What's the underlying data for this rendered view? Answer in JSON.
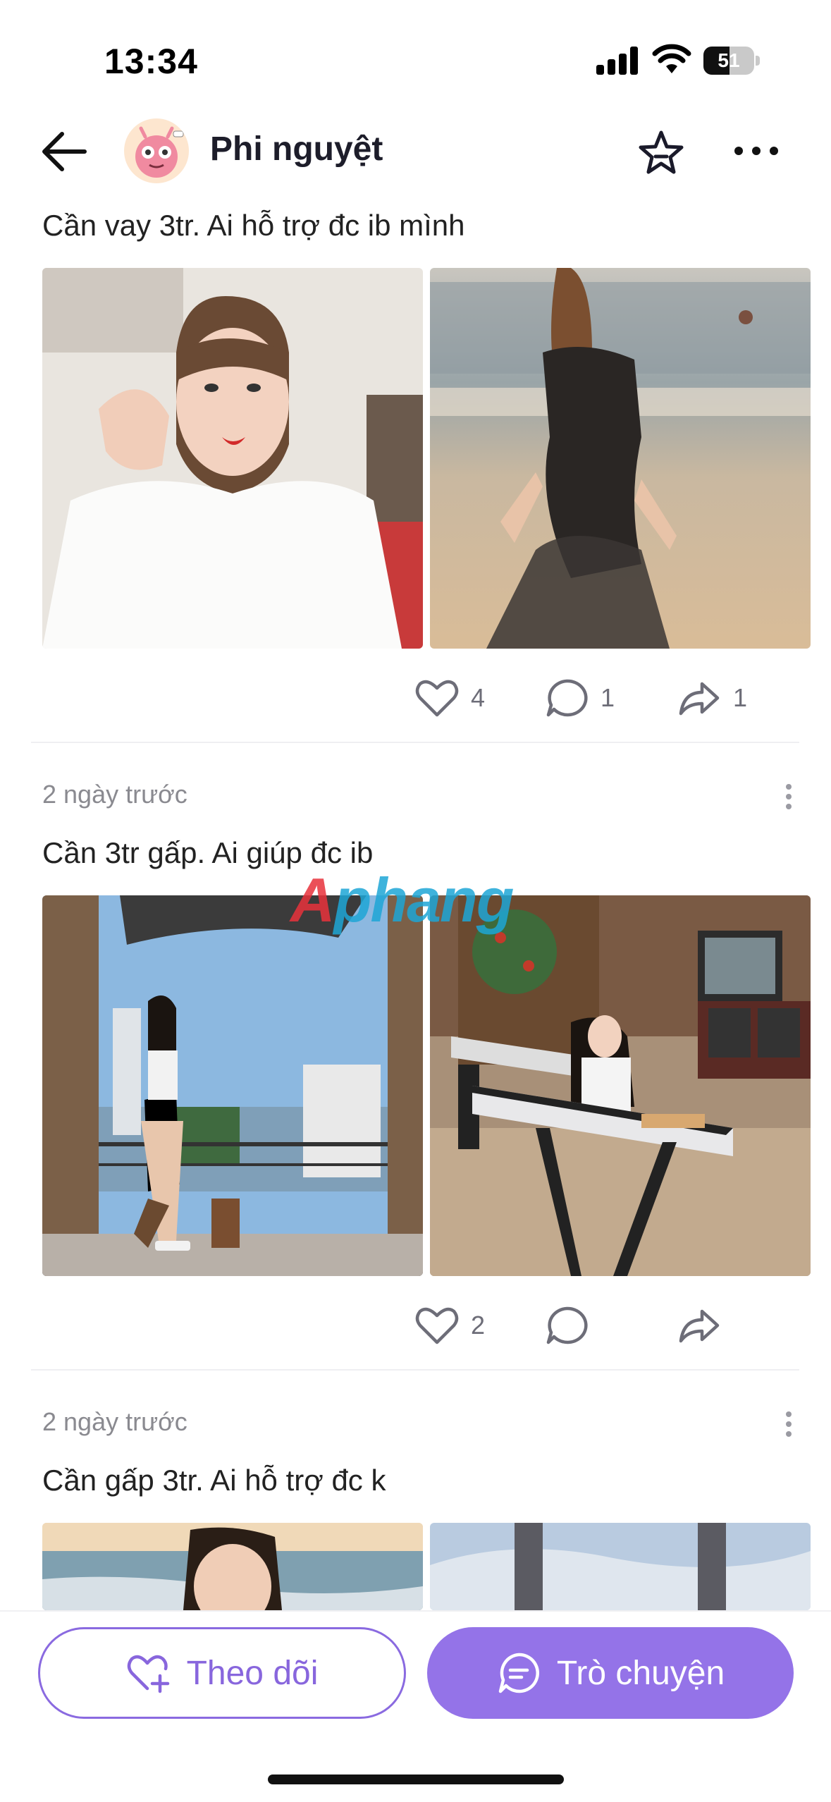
{
  "status_bar": {
    "time": "13:34",
    "battery": "51",
    "icons": [
      "cellular-signal-icon",
      "wifi-icon",
      "battery-icon"
    ]
  },
  "header": {
    "title": "Phi nguyệt",
    "icons": [
      "back-arrow-icon",
      "avatar",
      "star-icon",
      "more-horizontal-icon"
    ]
  },
  "posts": [
    {
      "time": "",
      "text": "Cần vay 3tr. Ai hỗ trợ đc ib mình",
      "likes": "4",
      "comments": "1",
      "shares": "1"
    },
    {
      "time": "2 ngày trước",
      "text": "Cần 3tr gấp. Ai giúp đc ib",
      "likes": "2",
      "comments": "",
      "shares": ""
    },
    {
      "time": "2 ngày trước",
      "text": "Cần gấp 3tr. Ai hỗ trợ đc k",
      "likes": "",
      "comments": "",
      "shares": ""
    }
  ],
  "watermark": {
    "part1": "A",
    "part2": "phang"
  },
  "bottom_bar": {
    "follow_label": "Theo dõi",
    "chat_label": "Trò chuyện"
  },
  "colors": {
    "accent": "#9473e8",
    "accent_text": "#8866dd",
    "muted": "#8a8a90"
  }
}
